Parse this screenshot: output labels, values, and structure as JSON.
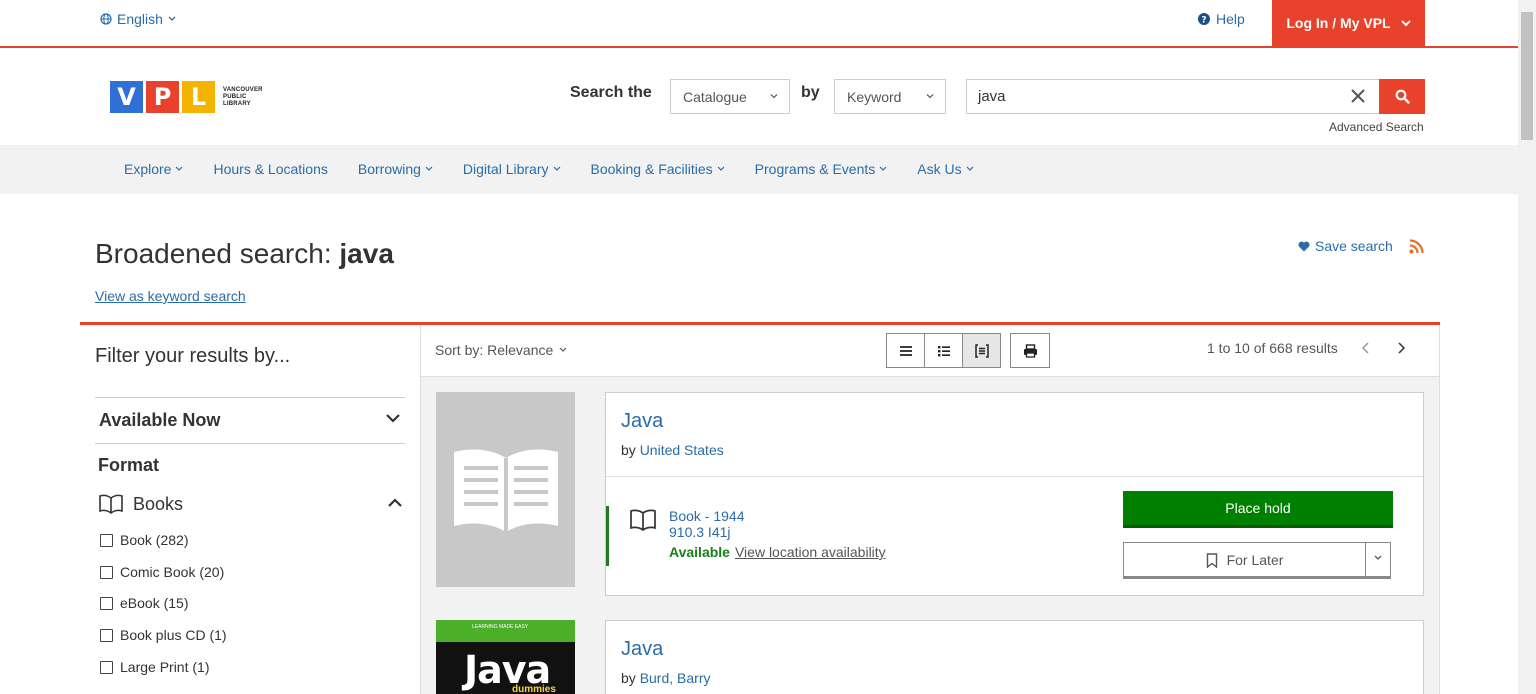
{
  "topbar": {
    "language": "English",
    "help": "Help",
    "login": "Log In / My VPL"
  },
  "logo": {
    "letters": [
      "V",
      "P",
      "L"
    ],
    "tile_colors": [
      "#2f6fd6",
      "#e8412c",
      "#f4b400"
    ],
    "name_lines": [
      "VANCOUVER",
      "PUBLIC",
      "LIBRARY"
    ]
  },
  "search": {
    "label_search_the": "Search the",
    "scope": "Catalogue",
    "label_by": "by",
    "field": "Keyword",
    "query": "java",
    "advanced": "Advanced Search"
  },
  "nav": {
    "items": [
      "Explore",
      "Hours & Locations",
      "Borrowing",
      "Digital Library",
      "Booking & Facilities",
      "Programs & Events",
      "Ask Us"
    ]
  },
  "heading": {
    "prefix": "Broadened search: ",
    "term": "java",
    "keyword_link": "View as keyword search",
    "save_search": "Save search"
  },
  "filters": {
    "title": "Filter your results by...",
    "available_now": "Available Now",
    "format_heading": "Format",
    "books_heading": "Books",
    "options": [
      "Book (282)",
      "Comic Book (20)",
      "eBook (15)",
      "Book plus CD (1)",
      "Large Print (1)"
    ]
  },
  "results_bar": {
    "sort": "Sort by: Relevance",
    "count": "1 to 10 of 668 results"
  },
  "results": [
    {
      "title": "Java",
      "by": "by",
      "author": "United States",
      "format": "Book - 1944",
      "call_number": "910.3 I41j",
      "availability": "Available",
      "location_link": "View location availability",
      "place_hold": "Place hold",
      "for_later": "For Later"
    },
    {
      "title": "Java",
      "by": "by",
      "author": "Burd, Barry",
      "cover_title": "Java",
      "cover_sub": "dummies",
      "cover_top": "LEARNING MADE EASY"
    }
  ],
  "colors": {
    "accent": "#e8412c",
    "link": "#2a6ca8",
    "available": "#1a7f1a",
    "hold_button": "#008000"
  }
}
